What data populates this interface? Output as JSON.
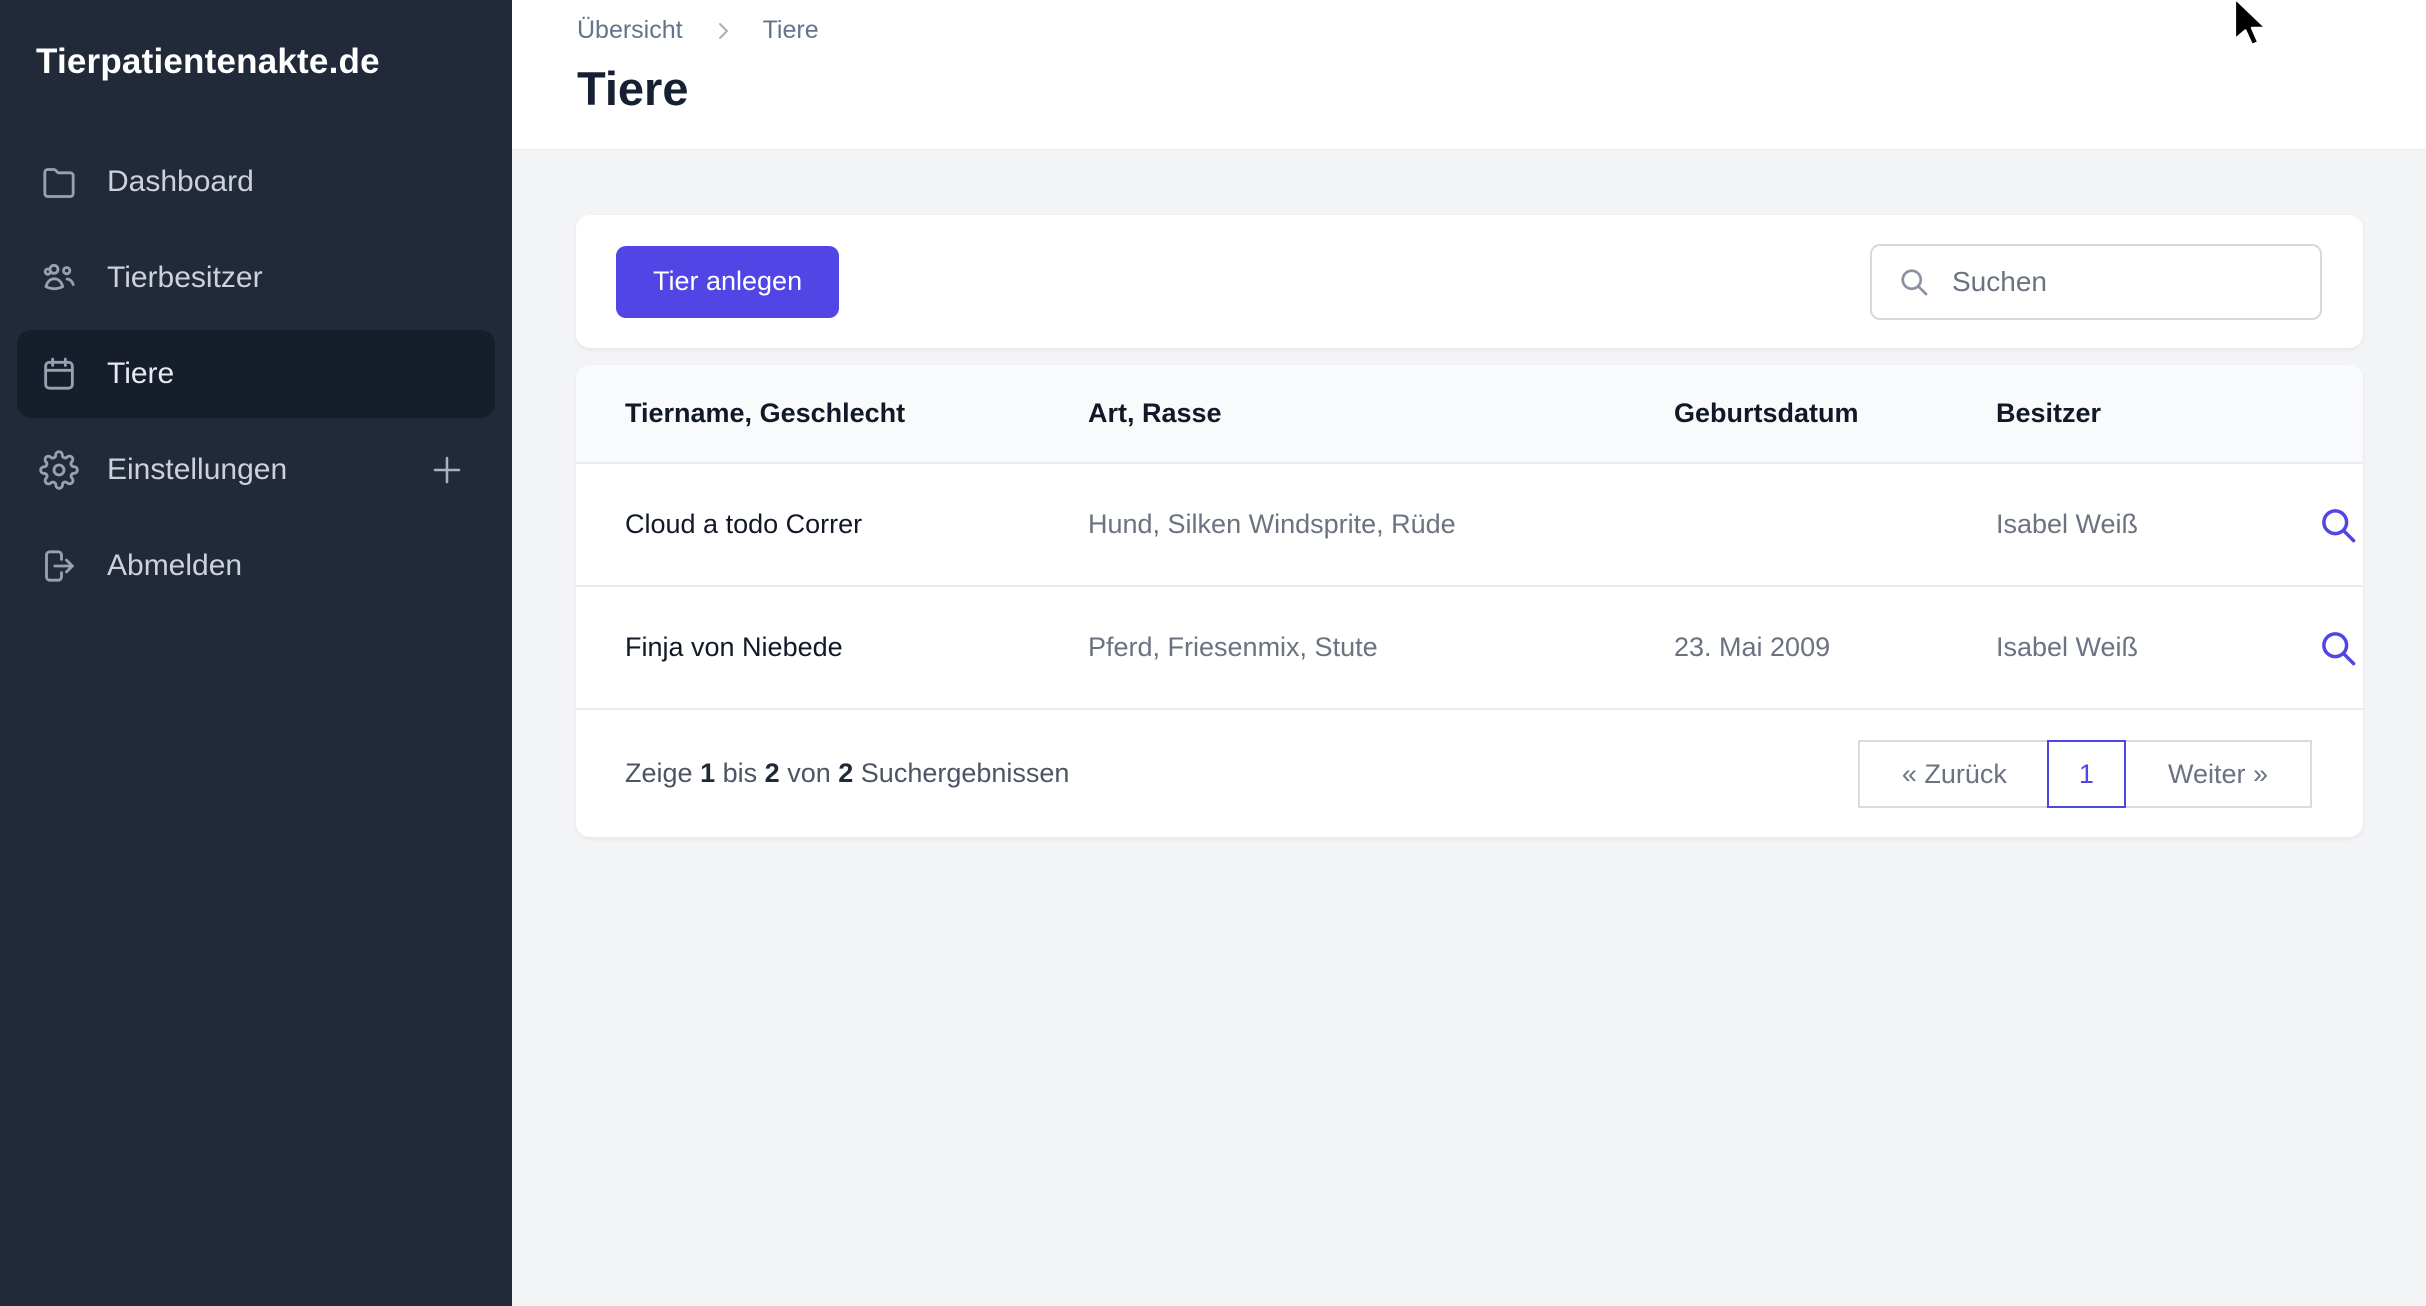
{
  "app": {
    "brand": "Tierpatientenakte.de"
  },
  "sidebar": {
    "items": [
      {
        "label": "Dashboard",
        "icon": "folder-icon",
        "active": false
      },
      {
        "label": "Tierbesitzer",
        "icon": "users-icon",
        "active": false
      },
      {
        "label": "Tiere",
        "icon": "calendar-icon",
        "active": true
      },
      {
        "label": "Einstellungen",
        "icon": "gear-icon",
        "active": false,
        "trailing_icon": "plus-icon"
      },
      {
        "label": "Abmelden",
        "icon": "logout-icon",
        "active": false
      }
    ]
  },
  "header": {
    "breadcrumb": [
      {
        "label": "Übersicht"
      },
      {
        "label": "Tiere"
      }
    ],
    "title": "Tiere"
  },
  "toolbar": {
    "create_button_label": "Tier anlegen",
    "search": {
      "placeholder": "Suchen",
      "value": ""
    }
  },
  "table": {
    "columns": [
      "Tiername, Geschlecht",
      "Art, Rasse",
      "Geburtsdatum",
      "Besitzer"
    ],
    "rows": [
      {
        "name": "Cloud a todo Correr",
        "art_rasse": "Hund, Silken Windsprite, Rüde",
        "geburtsdatum": "",
        "besitzer": "Isabel Weiß"
      },
      {
        "name": "Finja von Niebede",
        "art_rasse": "Pferd, Friesenmix, Stute",
        "geburtsdatum": "23. Mai 2009",
        "besitzer": "Isabel Weiß"
      }
    ],
    "footer": {
      "summary": {
        "prefix": "Zeige",
        "from": "1",
        "word_bis": "bis",
        "to": "2",
        "word_von": "von",
        "total": "2",
        "suffix": "Suchergebnissen"
      },
      "pagination": {
        "prev": "« Zurück",
        "page": "1",
        "next": "Weiter »"
      }
    }
  },
  "colors": {
    "sidebar_bg": "#222938",
    "sidebar_active_bg": "#161d2b",
    "accent_indigo": "#5145e5",
    "link_indigo": "#4f46e5",
    "content_bg": "#f3f4f6",
    "text_dark": "#111827",
    "text_gray": "#6b7280",
    "border_gray": "#e9ebef"
  }
}
